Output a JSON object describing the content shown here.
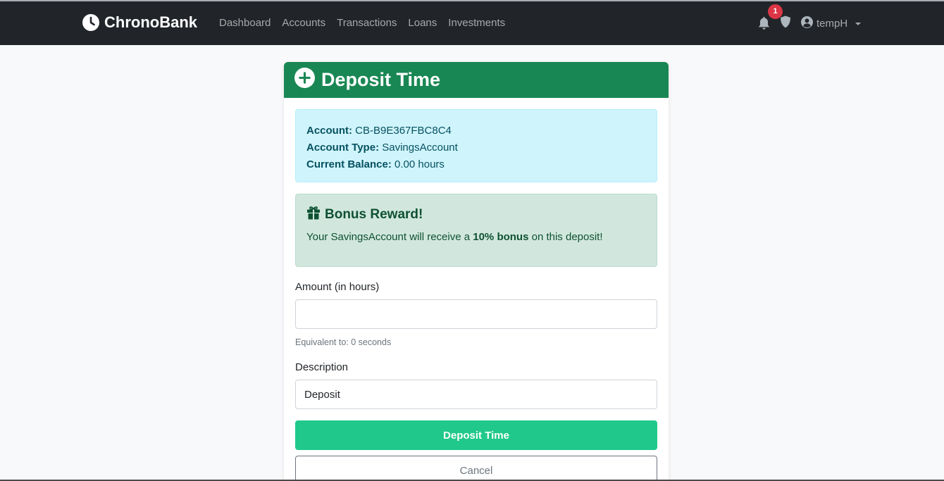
{
  "navbar": {
    "brand": "ChronoBank",
    "links": [
      "Dashboard",
      "Accounts",
      "Transactions",
      "Loans",
      "Investments"
    ],
    "notification_count": "1",
    "username": "tempH"
  },
  "card": {
    "title": "Deposit Time",
    "account_info": {
      "account_label": "Account:",
      "account_value": "CB-B9E367FBC8C4",
      "type_label": "Account Type:",
      "type_value": "SavingsAccount",
      "balance_label": "Current Balance:",
      "balance_value": "0.00 hours"
    },
    "bonus": {
      "title": "Bonus Reward!",
      "text_before": "Your SavingsAccount will receive a",
      "text_bold": "10% bonus",
      "text_after": "on this deposit!"
    },
    "form": {
      "amount_label": "Amount (in hours)",
      "amount_value": "",
      "equivalent_text": "Equivalent to: 0 seconds",
      "description_label": "Description",
      "description_value": "Deposit",
      "submit_label": "Deposit Time",
      "cancel_label": "Cancel"
    }
  },
  "colors": {
    "navbar_bg": "#212529",
    "header_bg": "#198754",
    "info_bg": "#cff4fc",
    "success_bg": "#d1e7dd",
    "button_bg": "#20c98b",
    "badge_bg": "#dc3545"
  },
  "icons": {
    "brand": "clock-icon",
    "bell": "bell-icon",
    "shield": "shield-icon",
    "user": "user-circle-icon",
    "header": "plus-circle-icon",
    "bonus": "gift-icon"
  }
}
